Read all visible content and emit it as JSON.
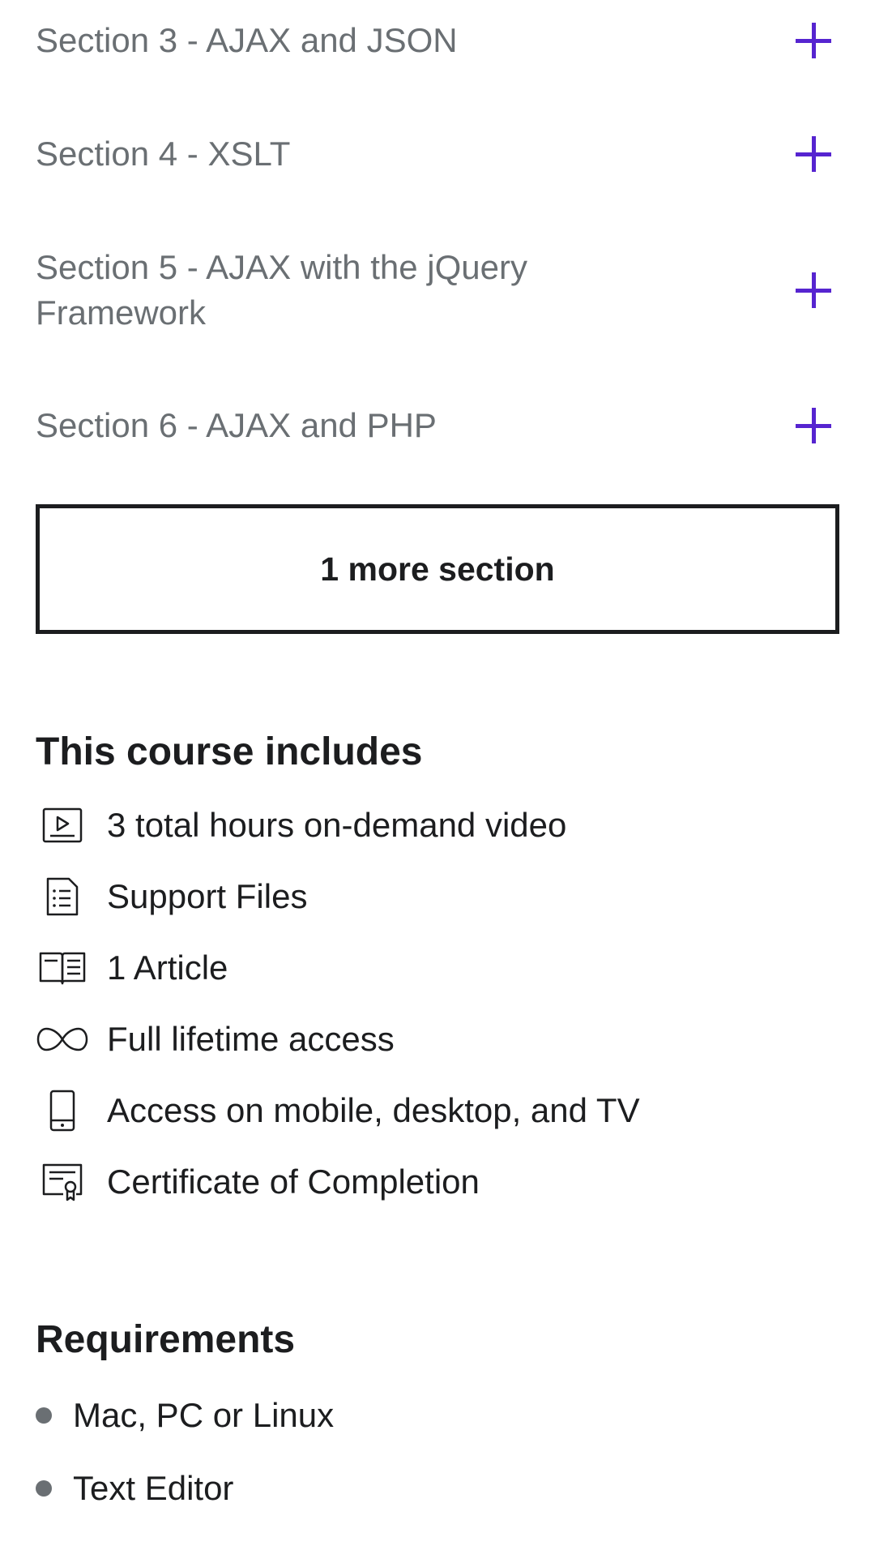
{
  "curriculum": {
    "sections": [
      {
        "title": "Section 3 - AJAX and JSON"
      },
      {
        "title": "Section 4 - XSLT"
      },
      {
        "title": "Section 5 - AJAX with the jQuery Framework"
      },
      {
        "title": "Section 6 - AJAX and PHP"
      }
    ],
    "more_button_label": "1 more section"
  },
  "includes": {
    "heading": "This course includes",
    "items": [
      {
        "icon": "video-icon",
        "text": "3 total hours on-demand video"
      },
      {
        "icon": "file-list-icon",
        "text": "Support Files"
      },
      {
        "icon": "article-icon",
        "text": "1 Article"
      },
      {
        "icon": "infinity-icon",
        "text": "Full lifetime access"
      },
      {
        "icon": "mobile-icon",
        "text": "Access on mobile, desktop, and TV"
      },
      {
        "icon": "certificate-icon",
        "text": "Certificate of Completion"
      }
    ]
  },
  "requirements": {
    "heading": "Requirements",
    "items": [
      {
        "text": "Mac, PC or Linux"
      },
      {
        "text": "Text Editor"
      }
    ]
  },
  "colors": {
    "accent": "#5624d0",
    "text_primary": "#1c1d1f",
    "text_muted": "#6a6f73"
  }
}
